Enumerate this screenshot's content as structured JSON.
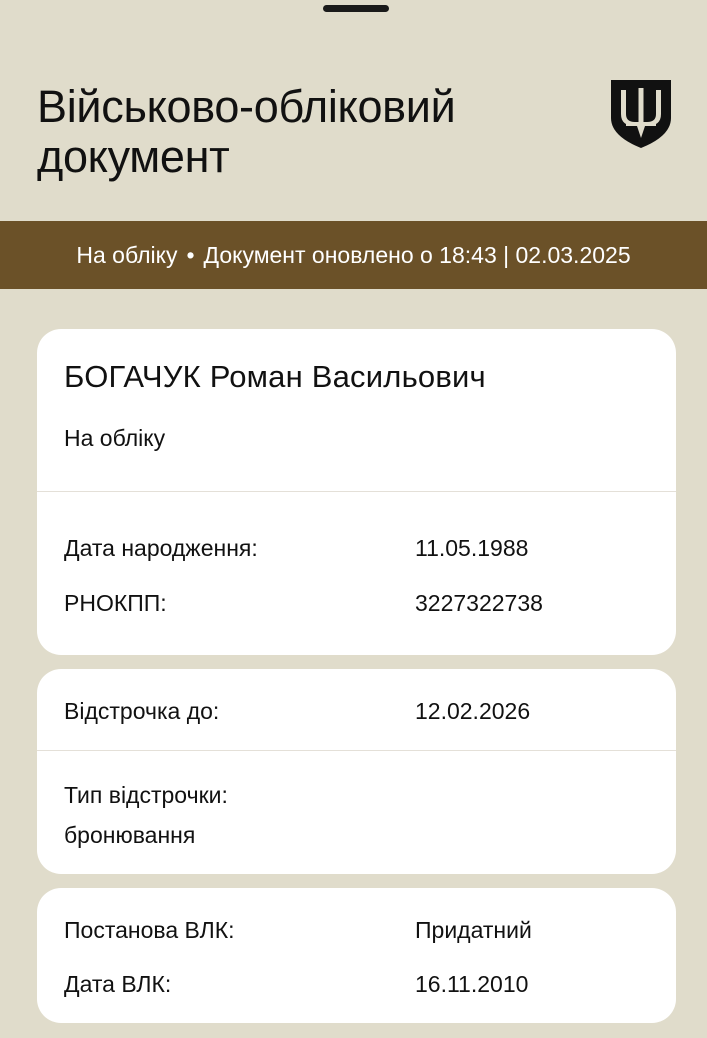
{
  "header": {
    "title_line1": "Військово-обліковий",
    "title_line2": "документ",
    "emblem_icon": "trident-shield-icon"
  },
  "status_bar": {
    "status": "На обліку",
    "separator": "•",
    "updated_text": "Документ оновлено о 18:43 | 02.03.2025"
  },
  "person": {
    "full_name": "БОГАЧУК Роман Васильович",
    "registration_status": "На обліку",
    "birth_date_label": "Дата народження:",
    "birth_date_value": "11.05.1988",
    "tax_id_label": "РНОКПП:",
    "tax_id_value": "3227322738"
  },
  "deferment": {
    "until_label": "Відстрочка до:",
    "until_value": "12.02.2026",
    "type_label": "Тип відстрочки:",
    "type_value": "бронювання"
  },
  "medical": {
    "decision_label": "Постанова ВЛК:",
    "decision_value": "Придатний",
    "date_label": "Дата ВЛК:",
    "date_value": "16.11.2010"
  },
  "colors": {
    "background": "#e0dccb",
    "status_bar": "#6b5128",
    "card": "#ffffff",
    "text": "#111111"
  }
}
